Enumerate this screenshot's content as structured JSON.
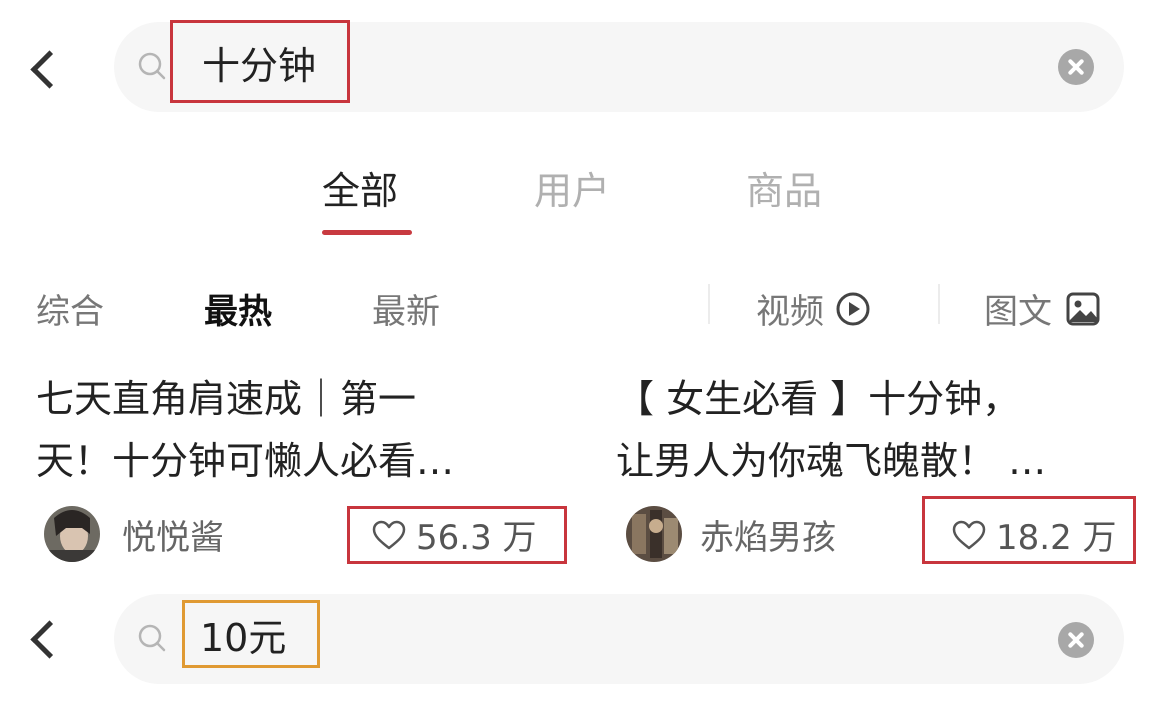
{
  "search_top": {
    "query": "十分钟"
  },
  "tabs": [
    "全部",
    "用户",
    "商品"
  ],
  "filters": {
    "comprehensive": "综合",
    "hottest": "最热",
    "newest": "最新",
    "video": "视频",
    "image_text": "图文"
  },
  "cards": [
    {
      "title_line1": "七天直角肩速成｜第一",
      "title_line2": "天！十分钟可懒人必看…",
      "author": "悦悦酱",
      "likes": "56.3 万"
    },
    {
      "title_line1": "【 女生必看 】十分钟，",
      "title_line2": "让男人为你魂飞魄散！ …",
      "author": "赤焰男孩",
      "likes": "18.2 万"
    }
  ],
  "search_bottom": {
    "query": "10元"
  },
  "colors": {
    "accent_red": "#c8353d",
    "highlight_orange": "#e09a33",
    "search_bg": "#f6f6f6"
  }
}
